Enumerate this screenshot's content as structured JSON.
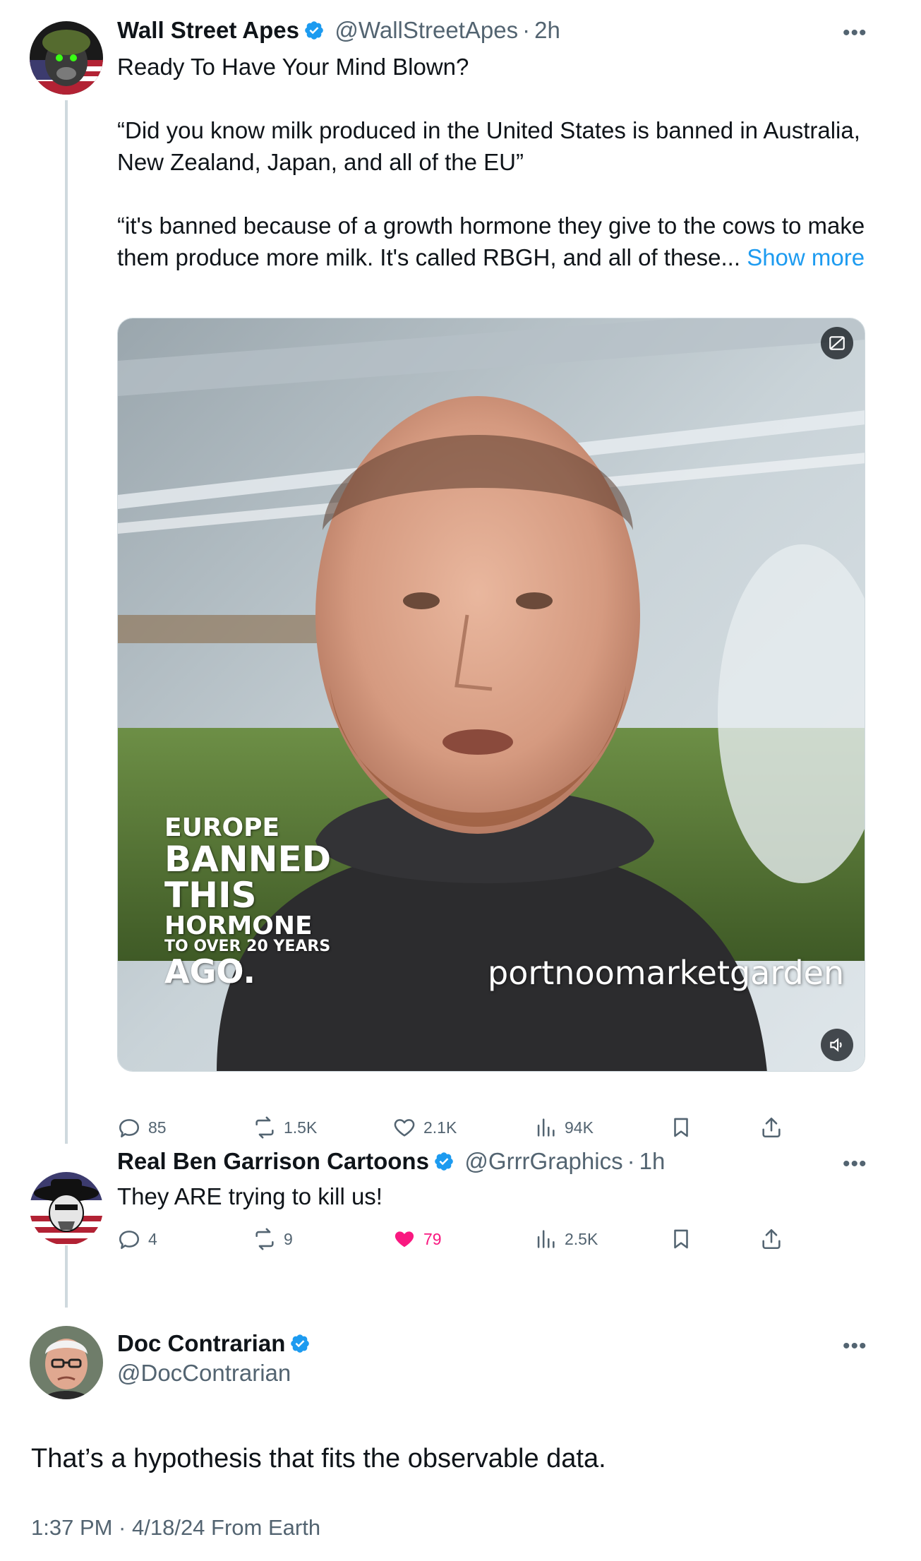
{
  "colors": {
    "link": "#1d9bf0",
    "like_active": "#f91880",
    "secondary": "#536471",
    "verified": "#1d9bf0"
  },
  "tweet1": {
    "name": "Wall Street Apes",
    "handle": "@WallStreetApes",
    "separator": "·",
    "time": "2h",
    "more_icon": "more-dots-icon",
    "text_line1": "Ready To Have Your Mind Blown?",
    "text_para2": "“Did you know milk produced in the United States is banned in Australia, New Zealand, Japan, and all of the EU”",
    "text_para3": "“it's banned because of a growth hormone they give to the cows to make them produce more milk. It's called RBGH, and all of these...",
    "show_more": "Show more",
    "video": {
      "overlay_line1": "EUROPE",
      "overlay_line2": "BANNED",
      "overlay_line3": "THIS",
      "overlay_line4": "HORMONE",
      "overlay_line5": "TO OVER 20 YEARS",
      "overlay_line6": "AGO.",
      "watermark": "portnoomarketgarden",
      "top_icon": "content-warning-icon",
      "volume_icon": "volume-icon"
    },
    "actions": {
      "replies": "85",
      "reposts": "1.5K",
      "likes": "2.1K",
      "views": "94K"
    }
  },
  "tweet2": {
    "name": "Real Ben Garrison Cartoons",
    "handle": "@GrrrGraphics",
    "separator": "·",
    "time": "1h",
    "text": "They ARE trying to kill us!",
    "actions": {
      "replies": "4",
      "reposts": "9",
      "likes": "79",
      "views": "2.5K"
    },
    "liked": true
  },
  "tweet3": {
    "name": "Doc Contrarian",
    "handle": "@DocContrarian",
    "text": "That’s a hypothesis that fits the observable data.",
    "timestamp": "1:37 PM · 4/18/24 From Earth"
  }
}
